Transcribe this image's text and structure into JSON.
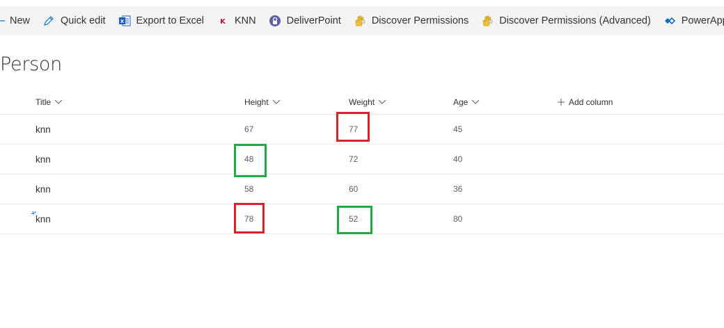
{
  "toolbar": {
    "items": [
      {
        "label": "New",
        "icon": "plus-icon"
      },
      {
        "label": "Quick edit",
        "icon": "pencil-icon"
      },
      {
        "label": "Export to Excel",
        "icon": "excel-icon"
      },
      {
        "label": "KNN",
        "icon": "knn-icon"
      },
      {
        "label": "DeliverPoint",
        "icon": "deliverpoint-icon"
      },
      {
        "label": "Discover Permissions",
        "icon": "hand-icon"
      },
      {
        "label": "Discover Permissions (Advanced)",
        "icon": "hand-icon"
      },
      {
        "label": "PowerApps",
        "icon": "powerapps-icon"
      }
    ],
    "more": "+"
  },
  "list": {
    "title": "Person",
    "columns": {
      "title": "Title",
      "height": "Height",
      "weight": "Weight",
      "age": "Age",
      "add": "Add column"
    },
    "rows": [
      {
        "title": "knn",
        "height": "67",
        "weight": "77",
        "age": "45"
      },
      {
        "title": "knn",
        "height": "48",
        "weight": "72",
        "age": "40"
      },
      {
        "title": "knn",
        "height": "58",
        "weight": "60",
        "age": "36"
      },
      {
        "title": "knn",
        "height": "78",
        "weight": "52",
        "age": "80"
      }
    ]
  },
  "colors": {
    "highlight_red": "#d9222a",
    "highlight_green": "#22a946",
    "accent": "#0078d4"
  }
}
